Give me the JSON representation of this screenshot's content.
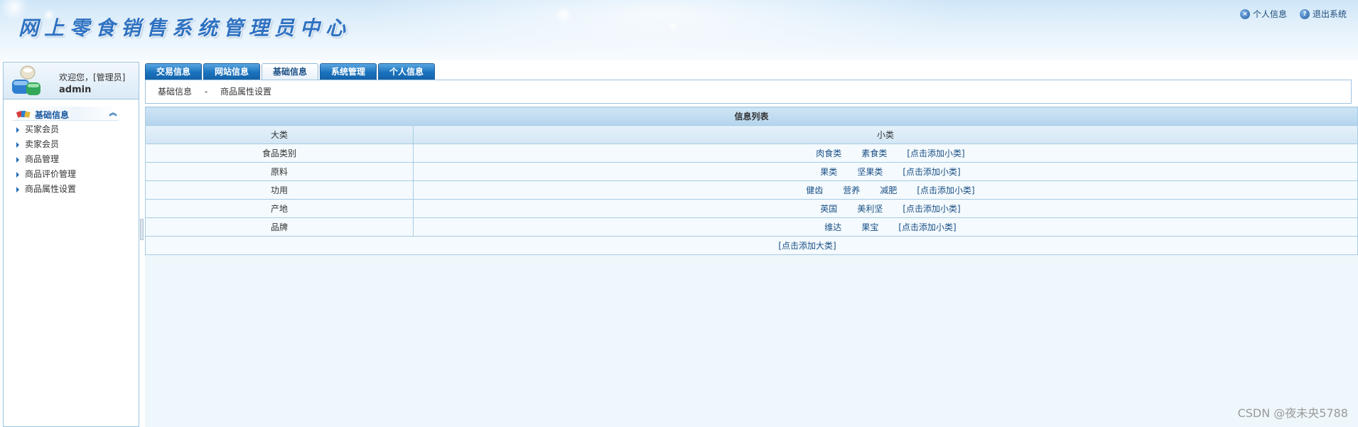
{
  "header": {
    "title": "网上零食销售系统管理员中心",
    "links": [
      {
        "label": "个人信息",
        "icon": "close-circle-icon"
      },
      {
        "label": "退出系统",
        "icon": "help-icon"
      }
    ]
  },
  "user": {
    "welcome": "欢迎您，[管理员]",
    "name": "admin"
  },
  "sidebar": {
    "section_label": "基础信息",
    "items": [
      {
        "label": "买家会员"
      },
      {
        "label": "卖家会员"
      },
      {
        "label": "商品管理"
      },
      {
        "label": "商品评价管理"
      },
      {
        "label": "商品属性设置"
      }
    ]
  },
  "tabs": [
    {
      "label": "交易信息",
      "active": false
    },
    {
      "label": "网站信息",
      "active": false
    },
    {
      "label": "基础信息",
      "active": true
    },
    {
      "label": "系统管理",
      "active": false
    },
    {
      "label": "个人信息",
      "active": false
    }
  ],
  "breadcrumb": {
    "section": "基础信息",
    "separator": "-",
    "page": "商品属性设置"
  },
  "table": {
    "caption": "信息列表",
    "columns": [
      "大类",
      "小类"
    ],
    "add_sub_label": "[点击添加小类]",
    "rows": [
      {
        "category": "食品类别",
        "subs": [
          "肉食类",
          "素食类"
        ]
      },
      {
        "category": "原料",
        "subs": [
          "果类",
          "坚果类"
        ]
      },
      {
        "category": "功用",
        "subs": [
          "健齿",
          "营养",
          "减肥"
        ]
      },
      {
        "category": "产地",
        "subs": [
          "英国",
          "美利坚"
        ]
      },
      {
        "category": "品牌",
        "subs": [
          "维达",
          "果宝"
        ]
      }
    ],
    "add_category_label": "[点击添加大类]"
  },
  "watermark": "CSDN @夜未央5788",
  "colors": {
    "tab_blue": "#1a72bd",
    "link_blue": "#1a4f86",
    "border": "#a7cce4"
  }
}
